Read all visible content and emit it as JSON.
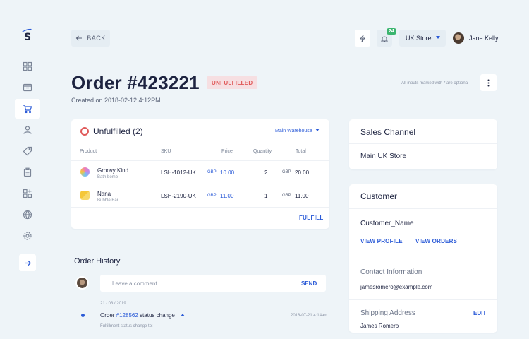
{
  "header": {
    "back_label": "BACK",
    "notification_count": "24",
    "store": "UK Store",
    "user_name": "Jane Kelly"
  },
  "order": {
    "title": "Order #423221",
    "status": "UNFULFILLED",
    "created_on": "Created on 2018-02-12 4:12PM",
    "inputs_note": "All inputs marked with * are optional"
  },
  "unfulfilled": {
    "title": "Unfulfilled (2)",
    "warehouse": "Main Warehouse",
    "columns": [
      "Product",
      "SKU",
      "Price",
      "Quantity",
      "Total"
    ],
    "items": [
      {
        "name": "Groovy Kind",
        "type": "Bath bomb",
        "sku": "LSH-1012-UK",
        "price_currency": "GBP",
        "price": "10.00",
        "quantity": "2",
        "total_currency": "GBP",
        "total": "20.00",
        "thumb_color": "#b78cf0"
      },
      {
        "name": "Nana",
        "type": "Bubble Bar",
        "sku": "LSH-2190-UK",
        "price_currency": "GBP",
        "price": "11.00",
        "quantity": "1",
        "total_currency": "GBP",
        "total": "11.00",
        "thumb_color": "#f5c739"
      }
    ],
    "fulfill_label": "FULFILL"
  },
  "sales_channel": {
    "title": "Sales Channel",
    "value": "Main UK Store"
  },
  "customer": {
    "title": "Customer",
    "name": "Customer_Name",
    "view_profile": "VIEW PROFILE",
    "view_orders": "VIEW ORDERS",
    "contact_label": "Contact Information",
    "email": "jamesromero@example.com",
    "shipping_label": "Shipping Address",
    "edit_label": "EDIT",
    "shipping_name": "James Romero"
  },
  "history": {
    "title": "Order History",
    "comment_placeholder": "Leave a comment",
    "send_label": "SEND",
    "date": "21 / 03 / 2019",
    "event_prefix": "Order ",
    "event_link": "#128562",
    "event_suffix": " status change",
    "event_time": "2018-07-21 4:14am",
    "event_sub": "Fulfillment status change to:"
  },
  "colors": {
    "accent": "#2a5ad7",
    "status_red": "#e05a5a",
    "badge_green": "#3bb56f",
    "background": "#eef4f8"
  },
  "icons": {
    "nav": [
      "dashboard-icon",
      "inbox-icon",
      "cart-icon",
      "user-icon",
      "tag-icon",
      "clipboard-icon",
      "apps-icon",
      "globe-icon",
      "settings-icon"
    ],
    "collapse": "arrow-right-icon"
  }
}
